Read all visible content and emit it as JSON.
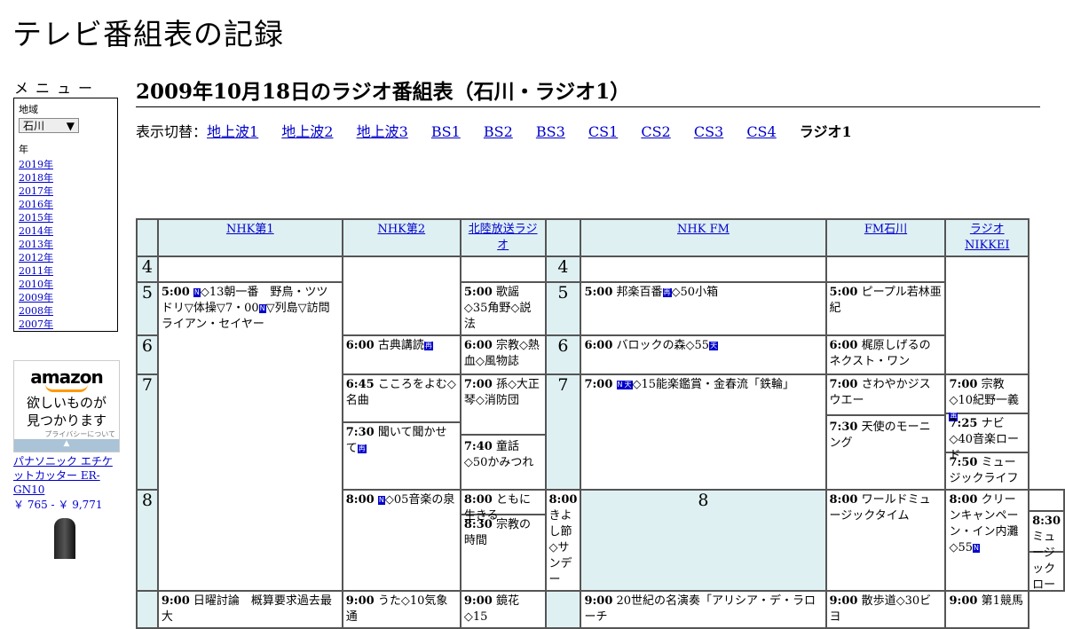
{
  "site_title": "テレビ番組表の記録",
  "menu": {
    "title": "メニュー",
    "region_label": "地域",
    "region_value": "石川",
    "year_label": "年",
    "years": [
      "2019年",
      "2018年",
      "2017年",
      "2016年",
      "2015年",
      "2014年",
      "2013年",
      "2012年",
      "2011年",
      "2010年",
      "2009年",
      "2008年",
      "2007年"
    ]
  },
  "ad": {
    "logo": "amazon",
    "line1": "欲しいものが",
    "line2": "見つかります",
    "privacy": "プライバシーについて",
    "product_name": "パナソニック エチケットカッター ER-GN10",
    "product_price": "￥ 765 - ￥ 9,771"
  },
  "heading": "2009年10月18日のラジオ番組表（石川・ラジオ1）",
  "switcher": {
    "label": "表示切替：",
    "links": [
      "地上波1",
      "地上波2",
      "地上波3",
      "BS1",
      "BS2",
      "BS3",
      "CS1",
      "CS2",
      "CS3",
      "CS4"
    ],
    "current": "ラジオ1"
  },
  "channels": [
    "NHK第1",
    "NHK第2",
    "北陸放送ラジオ",
    "NHK FM",
    "FM石川",
    "ラジオNIKKEI"
  ],
  "hours": [
    "4",
    "5",
    "6",
    "7",
    "8"
  ],
  "programs": {
    "nhk1_500_time": "5:00",
    "nhk1_500_title": "◇13朝一番　野鳥・ツツドリ▽体操▽7・00",
    "nhk1_500_title2": "▽列島▽訪問ライアン・セイヤー",
    "nhk1_800_time": "8:00",
    "nhk1_800_title": "◇05音楽の泉",
    "nhk1_900_time": "9:00",
    "nhk1_900_title": "日曜討論　概算要求過去最大",
    "nhk2_600_time": "6:00",
    "nhk2_600_title": "古典講読",
    "nhk2_645_time": "6:45",
    "nhk2_645_title": "こころをよむ◇名曲",
    "nhk2_730_time": "7:30",
    "nhk2_730_title": "聞いて聞かせて",
    "nhk2_800_time": "8:00",
    "nhk2_800_title": "ともに生きる",
    "nhk2_830_time": "8:30",
    "nhk2_830_title": "宗教の時間",
    "nhk2_900_time": "9:00",
    "nhk2_900_title": "うた◇10気象通",
    "mro_500_time": "5:00",
    "mro_500_title": "歌謡◇35角野◇説法",
    "mro_600_time": "6:00",
    "mro_600_title": "宗教◇熱血◇風物誌",
    "mro_700_time": "7:00",
    "mro_700_title": "孫◇大正琴◇消防団",
    "mro_740_time": "7:40",
    "mro_740_title": "童話◇50かみつれ",
    "mro_800_time": "8:00",
    "mro_800_title": "きよし節◇サンデー",
    "mro_900_time": "9:00",
    "mro_900_title": "鏡花◇15",
    "fm_500_time": "5:00",
    "fm_500_title": "邦楽百番",
    "fm_500_title2": "◇50小箱",
    "fm_600_time": "6:00",
    "fm_600_title": "バロックの森◇55",
    "fm_700_time": "7:00",
    "fm_700_title": "◇15能楽鑑賞・金春流「鉄輪」",
    "fm_800_time": "8:00",
    "fm_800_title": "ワールドミュージックタイム",
    "fm_900_time": "9:00",
    "fm_900_title": "20世紀の名演奏「アリシア・デ・ラローチ",
    "fmi_500_time": "5:00",
    "fmi_500_title": "ピープル若林亜紀",
    "fmi_600_time": "6:00",
    "fmi_600_title": "梶原しげるのネクスト・ワン",
    "fmi_700_time": "7:00",
    "fmi_700_title": "さわやかジスウエー",
    "fmi_730_time": "7:30",
    "fmi_730_title": "天使のモーニング",
    "fmi_800_time": "8:00",
    "fmi_800_title": "クリーンキャンペーン・イン内灘◇55",
    "fmi_900_time": "9:00",
    "fmi_900_title": "散歩道◇30ビヨ",
    "nikkei_700_time": "7:00",
    "nikkei_700_title": "宗教◇10紀野一義",
    "nikkei_725_time": "7:25",
    "nikkei_725_title": "ナビ◇40音楽ロード",
    "nikkei_750_time": "7:50",
    "nikkei_750_title": "ミュージックライフ",
    "nikkei_830_time": "8:30",
    "nikkei_830_title": "ミュージックロード",
    "nikkei_900_time": "9:00",
    "nikkei_900_title": "第1競馬"
  },
  "icons": {
    "n": "N",
    "ten": "天",
    "sai": "再"
  }
}
